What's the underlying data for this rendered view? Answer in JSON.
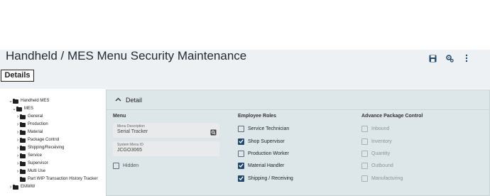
{
  "header": {
    "title": "Handheld / MES Menu Security Maintenance"
  },
  "tabs": [
    {
      "label": "Details"
    }
  ],
  "tree": {
    "items": [
      {
        "label": "Handheld MES"
      },
      {
        "label": "MES"
      },
      {
        "label": "General"
      },
      {
        "label": "Production"
      },
      {
        "label": "Material"
      },
      {
        "label": "Package Control"
      },
      {
        "label": "Shipping/Receiving"
      },
      {
        "label": "Service"
      },
      {
        "label": "Supervisor"
      },
      {
        "label": "Multi Use"
      },
      {
        "label": "Part WIP Transaction History Tracker"
      },
      {
        "label": "EMWW"
      }
    ]
  },
  "panel": {
    "title": "Detail",
    "menu": {
      "heading": "Menu",
      "description_label": "Menu Description",
      "description_value": "Serial Tracker",
      "id_label": "System Menu ID",
      "id_value": "JCGO3065",
      "hidden_label": "Hidden",
      "hidden_checked": false
    },
    "employee_roles": {
      "heading": "Employee Roles",
      "items": [
        {
          "label": "Service Technician",
          "checked": false
        },
        {
          "label": "Shop Supervisor",
          "checked": true
        },
        {
          "label": "Production Worker",
          "checked": false
        },
        {
          "label": "Material Handler",
          "checked": true
        },
        {
          "label": "Shipping / Receiving",
          "checked": true
        }
      ]
    },
    "advanced_package_control": {
      "heading": "Advance Package Control",
      "items": [
        {
          "label": "Inbound",
          "checked": false
        },
        {
          "label": "Inventory",
          "checked": false
        },
        {
          "label": "Quantity",
          "checked": false
        },
        {
          "label": "Outbound",
          "checked": false
        },
        {
          "label": "Manufacturing",
          "checked": false
        }
      ]
    }
  },
  "colors": {
    "accent": "#204a6e",
    "panel_bg": "#dde7e9",
    "header_bg": "#eef1f3",
    "highlight": "#f4e21a"
  },
  "icons": [
    "save-icon",
    "settings-icon",
    "more-icon",
    "chevron-up-icon",
    "search-icon"
  ]
}
